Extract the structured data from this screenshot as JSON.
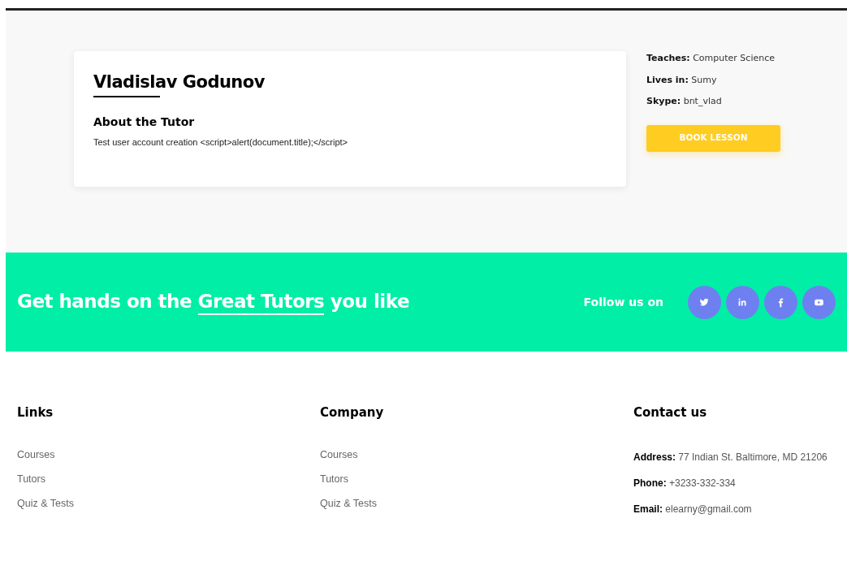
{
  "tutor": {
    "name": "Vladislav Godunov",
    "about_heading": "About the Tutor",
    "about_text": "Test user account creation <script>alert(document.title);</script>"
  },
  "details": [
    "**Teaches:** Computer Science",
    "**Lives in:** Sumy",
    "**Skype:** bnt_vlad"
  ],
  "book_button": "BOOK LESSON",
  "banner": {
    "text_before": "Get hands on the",
    "highlight": "Great Tutors",
    "text_after": "you like",
    "follow_label": "Follow us on",
    "socials": [
      {
        "kind": "twitter"
      },
      {
        "kind": "linkedin"
      },
      {
        "kind": "facebook"
      },
      {
        "kind": "youtube"
      }
    ]
  },
  "footer": [
    {
      "heading": "Links",
      "kind": "links",
      "items": [
        "Courses",
        "Tutors",
        "Quiz & Tests"
      ]
    },
    {
      "heading": "Company",
      "kind": "links",
      "items": [
        "Courses",
        "Tutors",
        "Quiz & Tests"
      ]
    },
    {
      "heading": "Contact us",
      "kind": "contact",
      "items": [
        "**Address:** 77 Indian St. Baltimore, MD 21206",
        "**Phone:** +3233-332-334",
        "**Email:** elearny@gmail.com"
      ]
    }
  ]
}
